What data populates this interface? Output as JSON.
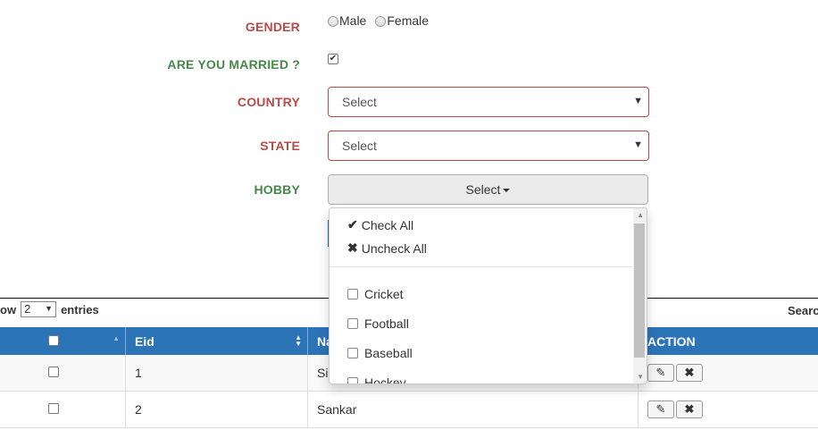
{
  "form": {
    "gender_label": "GENDER",
    "gender_options": [
      "Male",
      "Female"
    ],
    "married_label": "ARE YOU MARRIED ?",
    "married_checked": true,
    "country_label": "COUNTRY",
    "country_value": "Select",
    "state_label": "STATE",
    "state_value": "Select",
    "hobby_label": "HOBBY",
    "hobby_button": "Select"
  },
  "hobby_dropdown": {
    "check_all": "Check All",
    "uncheck_all": "Uncheck All",
    "items": [
      "Cricket",
      "Football",
      "Baseball",
      "Hockey"
    ]
  },
  "table_controls": {
    "show_prefix": "ow",
    "show_value": "2",
    "show_suffix": "entries",
    "search_label": "Searc"
  },
  "table": {
    "headers": [
      "",
      "Eid",
      "Na",
      "ACTION"
    ],
    "rows": [
      {
        "eid": "1",
        "name": "Si"
      },
      {
        "eid": "2",
        "name": "Sankar"
      }
    ]
  },
  "colors": {
    "required_label": "#b94a48",
    "optional_label": "#468847",
    "table_header": "#2c74b8"
  }
}
